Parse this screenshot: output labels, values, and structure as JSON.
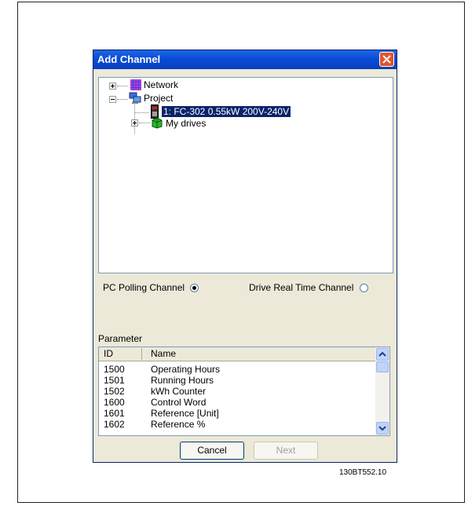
{
  "window": {
    "title": "Add Channel"
  },
  "tree": {
    "nodes": [
      {
        "label": "Network",
        "icon": "network-grid-icon",
        "expander": "plus"
      },
      {
        "label": "Project",
        "icon": "project-computer-icon",
        "expander": "minus"
      },
      {
        "label": "1: FC-302 0.55kW 200V-240V",
        "icon": "drive-device-icon",
        "selected": true
      },
      {
        "label": "My drives",
        "icon": "my-drives-icon",
        "expander": "plus"
      }
    ]
  },
  "channels": {
    "pc_polling_label": "PC Polling Channel",
    "pc_polling_selected": true,
    "drive_realtime_label": "Drive Real Time Channel",
    "drive_realtime_selected": false
  },
  "parameter": {
    "label": "Parameter",
    "columns": [
      "ID",
      "Name"
    ],
    "rows": [
      {
        "id": "1500",
        "name": "Operating Hours"
      },
      {
        "id": "1501",
        "name": "Running Hours"
      },
      {
        "id": "1502",
        "name": "kWh Counter"
      },
      {
        "id": "1600",
        "name": "Control Word"
      },
      {
        "id": "1601",
        "name": "Reference [Unit]"
      },
      {
        "id": "1602",
        "name": "Reference %"
      }
    ]
  },
  "buttons": {
    "cancel": "Cancel",
    "next": "Next"
  },
  "figure_code": "130BT552.10",
  "colors": {
    "titlebar": "#0a4cd6",
    "selection": "#0a246a",
    "dialog_bg": "#ece9d8"
  }
}
